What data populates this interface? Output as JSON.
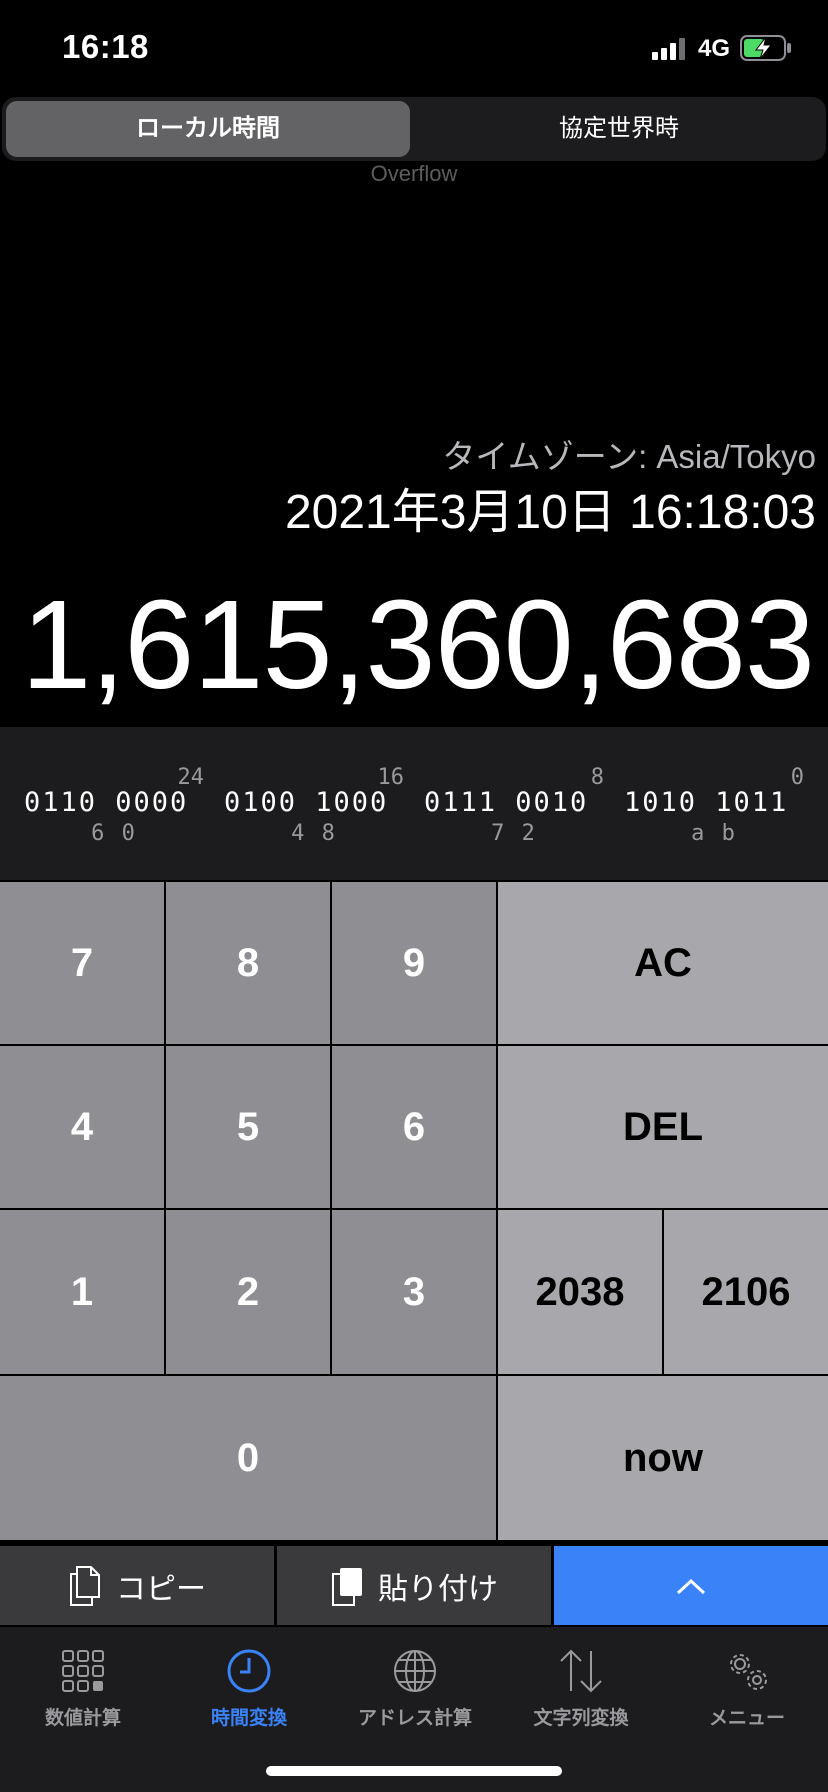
{
  "status_bar": {
    "time": "16:18",
    "network": "4G"
  },
  "segment": {
    "active": "ローカル時間",
    "other": "協定世界時"
  },
  "overflow_label": "Overflow",
  "timezone_label": "タイムゾーン: Asia/Tokyo",
  "datetime": "2021年3月10日 16:18:03",
  "unix_value": "1,615,360,683",
  "binary": [
    {
      "pos": "24",
      "bits": "0110 0000",
      "hex": "6 0"
    },
    {
      "pos": "16",
      "bits": "0100 1000",
      "hex": "4 8"
    },
    {
      "pos": "8",
      "bits": "0111 0010",
      "hex": "7 2"
    },
    {
      "pos": "0",
      "bits": "1010 1011",
      "hex": "a b"
    }
  ],
  "keys": {
    "k7": "7",
    "k8": "8",
    "k9": "9",
    "ac": "AC",
    "k4": "4",
    "k5": "5",
    "k6": "6",
    "del": "DEL",
    "k1": "1",
    "k2": "2",
    "k3": "3",
    "y2038": "2038",
    "y2106": "2106",
    "k0": "0",
    "now": "now"
  },
  "actions": {
    "copy": "コピー",
    "paste": "貼り付け"
  },
  "tabs": [
    {
      "label": "数値計算",
      "icon": "grid-icon"
    },
    {
      "label": "時間変換",
      "icon": "clock-icon"
    },
    {
      "label": "アドレス計算",
      "icon": "globe-icon"
    },
    {
      "label": "文字列変換",
      "icon": "arrows-updown-icon"
    },
    {
      "label": "メニュー",
      "icon": "gear-icon"
    }
  ],
  "colors": {
    "accent": "#3a82f7",
    "key_number": "#8e8e93",
    "key_function": "#a8a8ac",
    "panel": "#1c1c1e"
  }
}
